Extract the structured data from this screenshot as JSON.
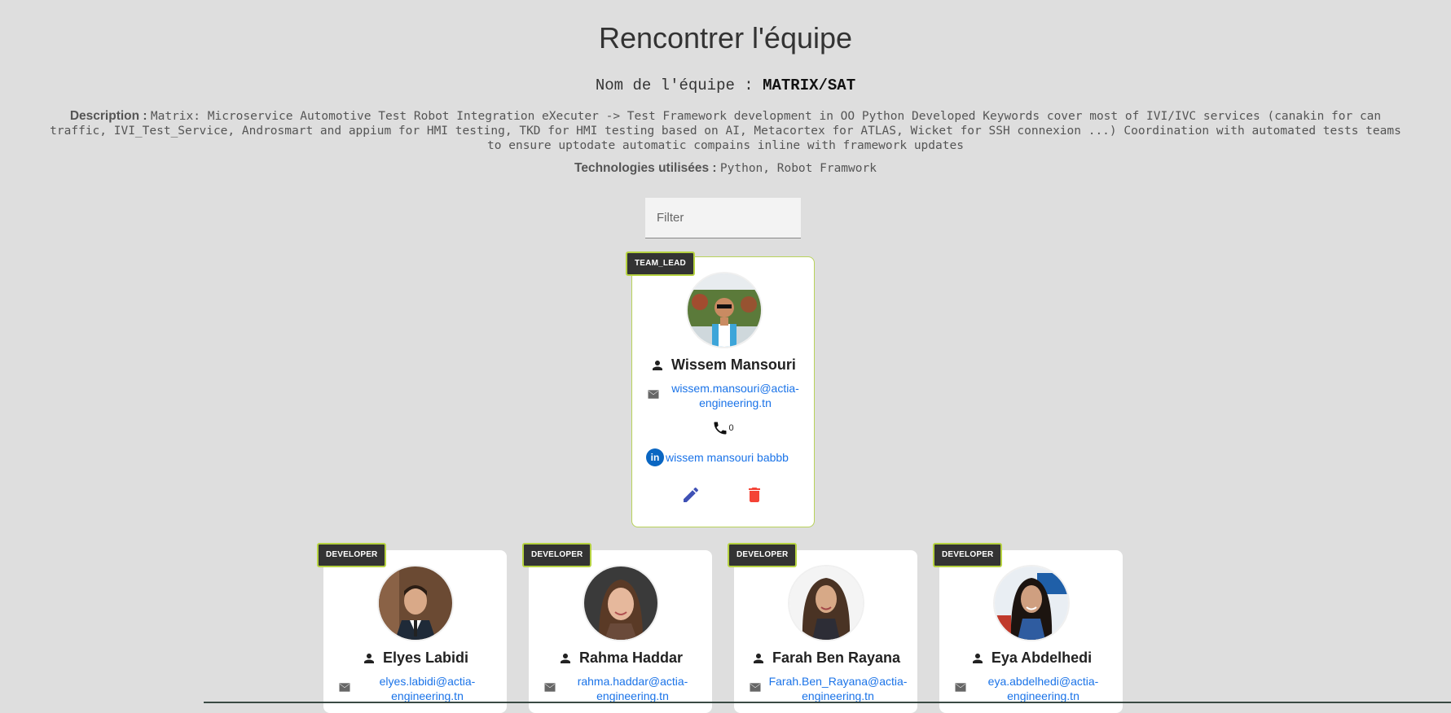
{
  "page": {
    "title": "Rencontrer l'équipe",
    "team_label": "Nom de l'équipe : ",
    "team_name": "MATRIX/SAT",
    "description_label": "Description : ",
    "description_text": "Matrix: Microservice Automotive Test Robot Integration eXecuter -> Test Framework development in OO Python Developed Keywords cover most of IVI/IVC services (canakin for can traffic, IVI_Test_Service, Androsmart and appium for HMI testing, TKD for HMI testing based on AI, Metacortex for ATLAS, Wicket for SSH connexion ...) Coordination with automated tests teams to ensure uptodate automatic compains inline with framework updates",
    "tech_label": "Technologies utilisées : ",
    "tech_text": "Python, Robot Framwork"
  },
  "filter": {
    "placeholder": "Filter",
    "value": ""
  },
  "lead": {
    "role": "TEAM_LEAD",
    "name": "Wissem Mansouri",
    "email_line1": "wissem.mansouri@actia-",
    "email_line2": "engineering.tn",
    "phone": "0",
    "linkedin": "wissem mansouri babbb",
    "linkedin_icon_text": "in"
  },
  "developers": [
    {
      "role": "DEVELOPER",
      "name": "Elyes Labidi",
      "email_line1": "elyes.labidi@actia-",
      "email_line2": "engineering.tn"
    },
    {
      "role": "DEVELOPER",
      "name": "Rahma Haddar",
      "email_line1": "rahma.haddar@actia-",
      "email_line2": "engineering.tn"
    },
    {
      "role": "DEVELOPER",
      "name": "Farah Ben Rayana",
      "email_line1": "Farah.Ben_Rayana@actia-",
      "email_line2": "engineering.tn"
    },
    {
      "role": "DEVELOPER",
      "name": "Eya Abdelhedi",
      "email_line1": "eya.abdelhedi@actia-",
      "email_line2": "engineering.tn"
    }
  ],
  "colors": {
    "background": "#dedede",
    "badge_bg": "#333333",
    "badge_border": "#b6d241",
    "link": "#1a73e8",
    "edit": "#3f51b5",
    "delete": "#f44336",
    "linkedin": "#0a66c2"
  },
  "icons": {
    "person": "person-icon",
    "mail": "mail-icon",
    "phone": "phone-icon",
    "linkedin": "linkedin-icon",
    "edit": "edit-pencil-icon",
    "delete": "delete-trash-icon"
  }
}
